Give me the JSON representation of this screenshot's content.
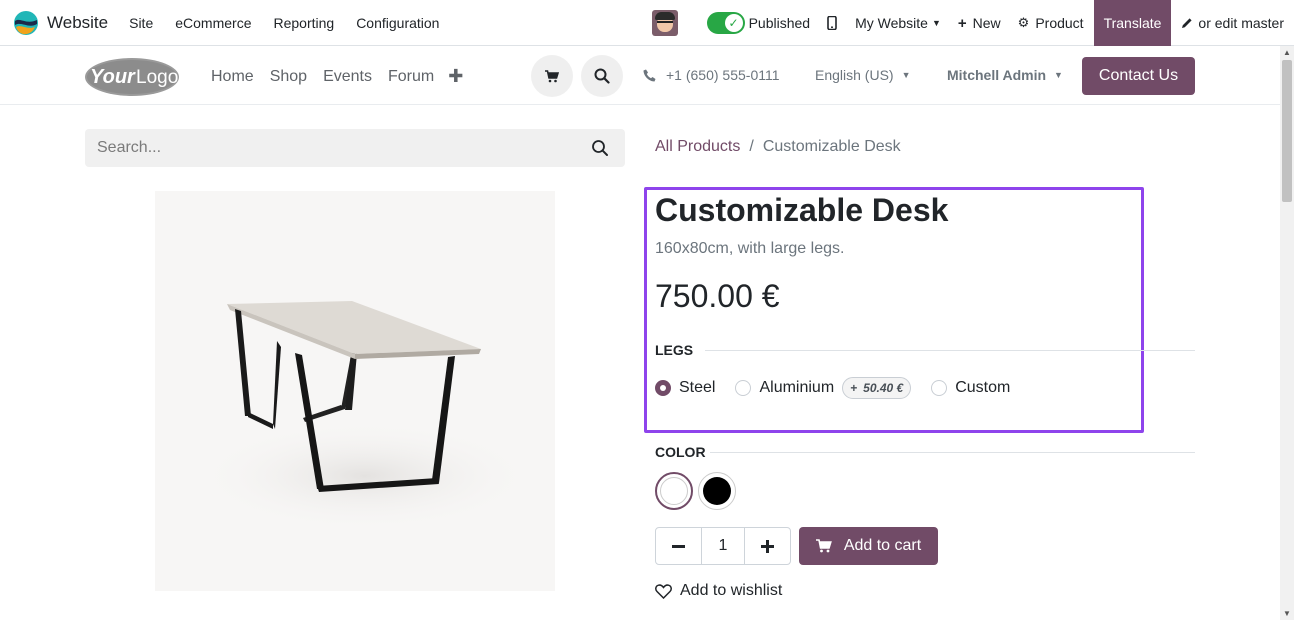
{
  "admin_bar": {
    "brand": "Website",
    "menus": [
      "Site",
      "eCommerce",
      "Reporting",
      "Configuration"
    ],
    "published_label": "Published",
    "my_website_label": "My Website",
    "new_label": "New",
    "product_label": "Product",
    "translate_label": "Translate",
    "edit_master_label": "or edit master"
  },
  "header": {
    "logo_text": "YourLogo",
    "nav": [
      "Home",
      "Shop",
      "Events",
      "Forum"
    ],
    "phone": "+1 (650) 555-0111",
    "language": "English (US)",
    "user": "Mitchell Admin",
    "contact_label": "Contact Us"
  },
  "search": {
    "placeholder": "Search..."
  },
  "breadcrumb": {
    "parent": "All Products",
    "separator": "/",
    "current": "Customizable Desk"
  },
  "product": {
    "name": "Customizable Desk",
    "description": "160x80cm, with large legs.",
    "price": "750.00 €",
    "attributes": {
      "legs": {
        "label": "LEGS",
        "options": [
          {
            "label": "Steel",
            "selected": true
          },
          {
            "label": "Aluminium",
            "extra": "50.40 €",
            "selected": false
          },
          {
            "label": "Custom",
            "selected": false
          }
        ],
        "extra_prefix": "+"
      },
      "color": {
        "label": "COLOR",
        "options": [
          {
            "color": "#ffffff",
            "selected": true
          },
          {
            "color": "#000000",
            "selected": false
          }
        ]
      }
    },
    "quantity": "1",
    "add_to_cart_label": "Add to cart",
    "wishlist_label": "Add to wishlist"
  },
  "colors": {
    "brand": "#714b67",
    "highlight": "#8e44ec",
    "published_toggle": "#28a745"
  }
}
